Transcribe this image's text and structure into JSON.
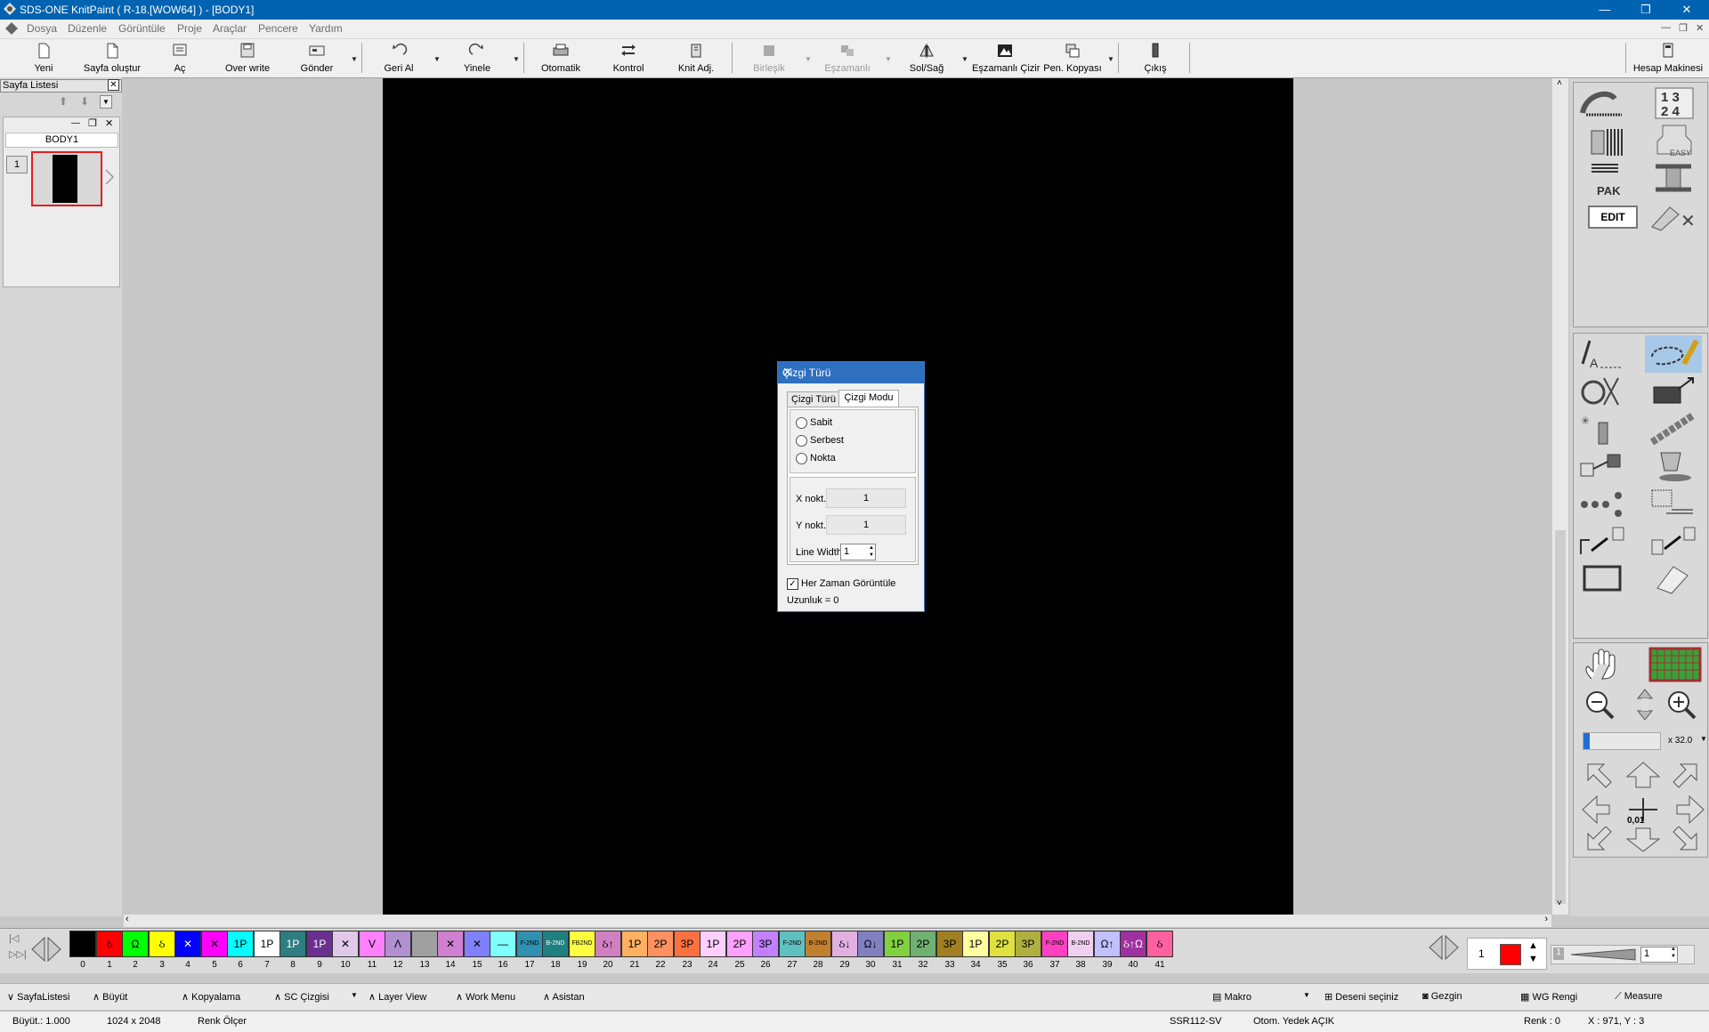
{
  "window": {
    "title": "SDS-ONE KnitPaint ( R-18.[WOW64] ) - [BODY1]",
    "minimize": "—",
    "restore": "❐",
    "close": "✕"
  },
  "menu": [
    "Dosya",
    "Düzenle",
    "Görüntüle",
    "Proje",
    "Araçlar",
    "Pencere",
    "Yardım"
  ],
  "toolbar": {
    "yeni": "Yeni",
    "sayfa_olustur": "Sayfa oluştur",
    "ac": "Aç",
    "over_write": "Over write",
    "gonder": "Gönder",
    "geri_al": "Geri Al",
    "yinele": "Yinele",
    "otomatik": "Otomatik",
    "kontrol": "Kontrol",
    "knit_adj": "Knit Adj.",
    "birlesik": "Birleşik",
    "eszamanli": "Eşzamanlı",
    "sol_sag": "Sol/Sağ",
    "eszamanli_cizir": "Eşzamanlı Çizir",
    "pen_kopyasi": "Pen. Kopyası",
    "cikis": "Çıkış",
    "hesap_makinesi": "Hesap Makinesi"
  },
  "page_list": {
    "title": "Sayfa Listesi",
    "page_name": "BODY1",
    "page_number": "1"
  },
  "dialog": {
    "title": "Çizgi Türü",
    "tab1": "Çizgi Türü",
    "tab2": "Çizgi Modu",
    "radio1": "Sabit",
    "radio2": "Serbest",
    "radio3": "Nokta",
    "x_label": "X nokt.",
    "x_value": "1",
    "y_label": "Y nokt.",
    "y_value": "1",
    "lw_label": "Line Width",
    "lw_value": "1",
    "checkbox_label": "Her Zaman Görüntüle",
    "length_text": "Uzunluk = 0"
  },
  "right_panel": {
    "zoom": "x 32.0",
    "step": "0,01",
    "edit_label": "EDIT",
    "pak_label": "PAK",
    "easy_label": "EASY"
  },
  "palette": {
    "swatches": [
      {
        "n": "0",
        "c": "#000000",
        "t": ""
      },
      {
        "n": "1",
        "c": "#ff0000",
        "t": "ઠ"
      },
      {
        "n": "2",
        "c": "#00ff00",
        "t": "Ω"
      },
      {
        "n": "3",
        "c": "#ffff00",
        "t": "ઠ"
      },
      {
        "n": "4",
        "c": "#0000ff",
        "t": "✕"
      },
      {
        "n": "5",
        "c": "#ff00ff",
        "t": "✕"
      },
      {
        "n": "6",
        "c": "#00ffff",
        "t": "1P"
      },
      {
        "n": "7",
        "c": "#ffffff",
        "t": "1P"
      },
      {
        "n": "8",
        "c": "#2e7d80",
        "t": "1P"
      },
      {
        "n": "9",
        "c": "#6a3090",
        "t": "1P"
      },
      {
        "n": "10",
        "c": "#e0c8e8",
        "t": "✕"
      },
      {
        "n": "11",
        "c": "#ff80ff",
        "t": "V"
      },
      {
        "n": "12",
        "c": "#b090d0",
        "t": "Λ"
      },
      {
        "n": "13",
        "c": "#a0a0a0",
        "t": ""
      },
      {
        "n": "14",
        "c": "#d080d0",
        "t": "✕"
      },
      {
        "n": "15",
        "c": "#8080ff",
        "t": "✕"
      },
      {
        "n": "16",
        "c": "#80ffff",
        "t": "—"
      },
      {
        "n": "17",
        "c": "#3090b0",
        "t": "F-2ND"
      },
      {
        "n": "18",
        "c": "#208080",
        "t": "B-2ND"
      },
      {
        "n": "19",
        "c": "#ffff40",
        "t": "FB2ND"
      },
      {
        "n": "20",
        "c": "#d080c0",
        "t": "ઠ↑"
      },
      {
        "n": "21",
        "c": "#ffb060",
        "t": "1P"
      },
      {
        "n": "22",
        "c": "#ff9060",
        "t": "2P"
      },
      {
        "n": "23",
        "c": "#ff7040",
        "t": "3P"
      },
      {
        "n": "24",
        "c": "#ffd0ff",
        "t": "1P"
      },
      {
        "n": "25",
        "c": "#ffa0ff",
        "t": "2P"
      },
      {
        "n": "26",
        "c": "#c080ff",
        "t": "3P"
      },
      {
        "n": "27",
        "c": "#60c0c0",
        "t": "F-2ND"
      },
      {
        "n": "28",
        "c": "#c08030",
        "t": "B-2ND"
      },
      {
        "n": "29",
        "c": "#e0b0e0",
        "t": "ઠ↓"
      },
      {
        "n": "30",
        "c": "#8080c0",
        "t": "Ω↓"
      },
      {
        "n": "31",
        "c": "#80d040",
        "t": "1P"
      },
      {
        "n": "32",
        "c": "#70b070",
        "t": "2P"
      },
      {
        "n": "33",
        "c": "#a08020",
        "t": "3P"
      },
      {
        "n": "34",
        "c": "#ffffa0",
        "t": "1P"
      },
      {
        "n": "35",
        "c": "#e0e040",
        "t": "2P"
      },
      {
        "n": "36",
        "c": "#b0b040",
        "t": "3P"
      },
      {
        "n": "37",
        "c": "#ff40c0",
        "t": "F-2ND"
      },
      {
        "n": "38",
        "c": "#f0d0f0",
        "t": "B-2ND"
      },
      {
        "n": "39",
        "c": "#c0c0ff",
        "t": "Ω↑"
      },
      {
        "n": "40",
        "c": "#a030a0",
        "t": "ઠ↑Ω"
      },
      {
        "n": "41",
        "c": "#ff60a0",
        "t": "ઠ"
      }
    ],
    "current_number": "1",
    "current_color": "#ff0000",
    "right_number": "1",
    "right_index": "1"
  },
  "bottom_bar": {
    "sayfa_listesi": "SayfaListesi",
    "buyut": "Büyüt",
    "kopyalama": "Kopyalama",
    "sc_cizgisi": "SC Çizgisi",
    "layer_view": "Layer View",
    "work_menu": "Work Menu",
    "asistan": "Asistan",
    "makro": "Makro",
    "deseni_seciniz": "Deseni seçiniz",
    "gezgin": "Gezgin",
    "wg_rengi": "WG Rengi",
    "measure": "Measure"
  },
  "status": {
    "buyut": "Büyüt.:  1.000",
    "size": "1024 x 2048",
    "renk_olcer": "Renk Ölçer",
    "ssr": "SSR112-SV",
    "otom": "Otom. Yedek AÇIK",
    "renk": "Renk :  0",
    "xy": "X : 971, Y :  3"
  }
}
